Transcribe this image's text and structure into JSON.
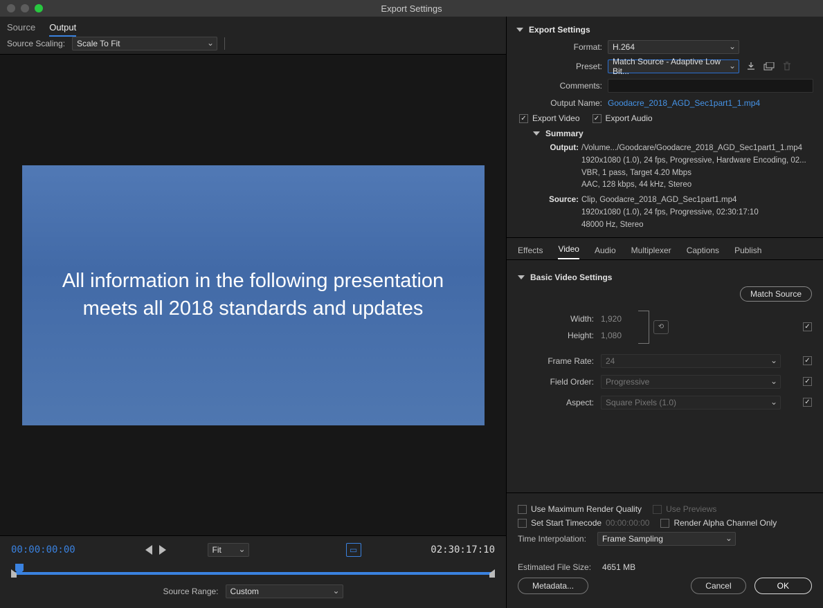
{
  "window": {
    "title": "Export Settings"
  },
  "left": {
    "tabs": {
      "source": "Source",
      "output": "Output"
    },
    "scaling_label": "Source Scaling:",
    "scaling_value": "Scale To Fit",
    "preview_text": "All information in the following presentation meets all 2018 standards and updates",
    "tc_in": "00:00:00:00",
    "tc_out": "02:30:17:10",
    "zoom_label": "Fit",
    "source_range_label": "Source Range:",
    "source_range_value": "Custom"
  },
  "export": {
    "heading": "Export Settings",
    "format_label": "Format:",
    "format_value": "H.264",
    "preset_label": "Preset:",
    "preset_value": "Match Source - Adaptive Low Bit...",
    "comments_label": "Comments:",
    "comments_value": "",
    "outputname_label": "Output Name:",
    "outputname_value": "Goodacre_2018_AGD_Sec1part1_1.mp4",
    "export_video_label": "Export Video",
    "export_audio_label": "Export Audio",
    "summary_heading": "Summary",
    "summary": {
      "output_label": "Output:",
      "output_l1": "/Volume.../Goodcare/Goodacre_2018_AGD_Sec1part1_1.mp4",
      "output_l2": "1920x1080 (1.0), 24 fps, Progressive, Hardware Encoding, 02...",
      "output_l3": "VBR, 1 pass, Target 4.20 Mbps",
      "output_l4": "AAC, 128 kbps, 44 kHz, Stereo",
      "source_label": "Source:",
      "source_l1": "Clip, Goodacre_2018_AGD_Sec1part1.mp4",
      "source_l2": "1920x1080 (1.0), 24 fps, Progressive, 02:30:17:10",
      "source_l3": "48000 Hz, Stereo"
    }
  },
  "tabs": {
    "effects": "Effects",
    "video": "Video",
    "audio": "Audio",
    "multiplexer": "Multiplexer",
    "captions": "Captions",
    "publish": "Publish"
  },
  "bvs": {
    "heading": "Basic Video Settings",
    "match_source": "Match Source",
    "width_label": "Width:",
    "width_value": "1,920",
    "height_label": "Height:",
    "height_value": "1,080",
    "framerate_label": "Frame Rate:",
    "framerate_value": "24",
    "fieldorder_label": "Field Order:",
    "fieldorder_value": "Progressive",
    "aspect_label": "Aspect:",
    "aspect_value": "Square Pixels (1.0)"
  },
  "bottom": {
    "use_max_render": "Use Maximum Render Quality",
    "use_previews": "Use Previews",
    "set_start_tc": "Set Start Timecode",
    "start_tc_value": "00:00:00:00",
    "render_alpha": "Render Alpha Channel Only",
    "time_interp_label": "Time Interpolation:",
    "time_interp_value": "Frame Sampling",
    "est_size_label": "Estimated File Size:",
    "est_size_value": "4651 MB",
    "metadata": "Metadata...",
    "cancel": "Cancel",
    "ok": "OK"
  }
}
